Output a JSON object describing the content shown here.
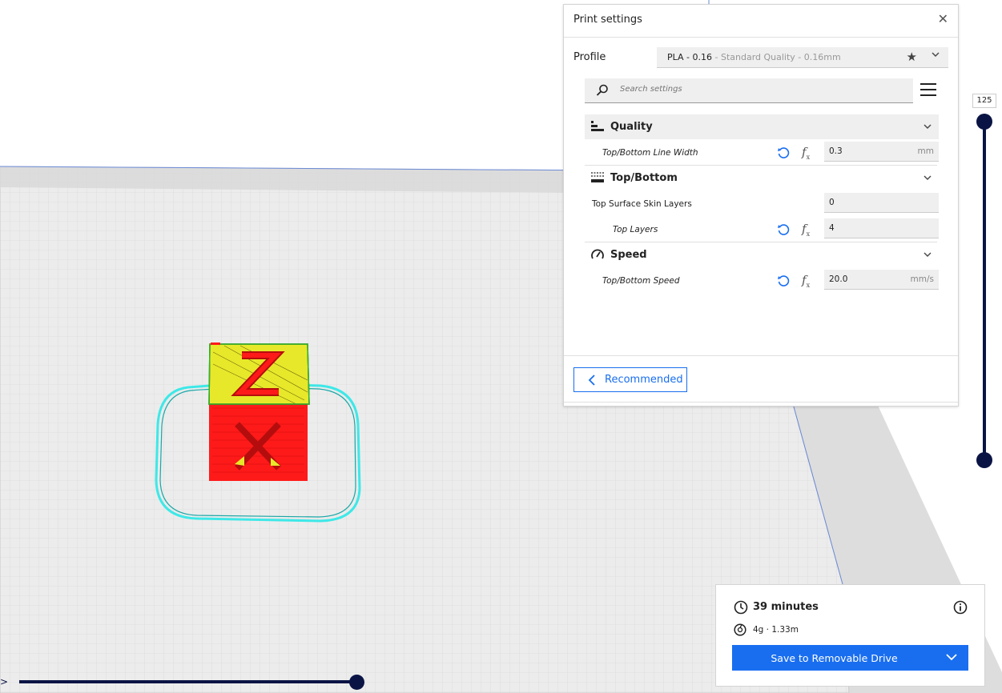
{
  "print_settings": {
    "title": "Print settings",
    "profile_label": "Profile",
    "profile_value": "PLA - 0.16",
    "profile_detail": " - Standard Quality - 0.16mm",
    "search_placeholder": "Search settings",
    "categories": [
      {
        "label": "Quality",
        "icon": "quality-icon",
        "settings": [
          {
            "label": "Top/Bottom Line Width",
            "value": "0.3",
            "unit": "mm"
          }
        ]
      },
      {
        "label": "Top/Bottom",
        "icon": "top-bottom-icon",
        "settings": [
          {
            "label": "Top Surface Skin Layers",
            "value": "0",
            "unit": ""
          },
          {
            "label": "Top Layers",
            "value": "4",
            "unit": ""
          }
        ]
      },
      {
        "label": "Speed",
        "icon": "speed-icon",
        "settings": [
          {
            "label": "Top/Bottom Speed",
            "value": "20.0",
            "unit": "mm/s"
          }
        ]
      }
    ],
    "recommended_label": "Recommended"
  },
  "layer_slider": {
    "top_value": "125"
  },
  "print_info": {
    "time": "39 minutes",
    "material": "4g · 1.33m",
    "save_label": "Save to Removable Drive"
  },
  "colors": {
    "accent": "#196ef0",
    "slider": "#0a1444",
    "model_red": "#ff1a1a",
    "model_yellow": "#e8e82a",
    "skirt_cyan": "#3ee8e8"
  }
}
